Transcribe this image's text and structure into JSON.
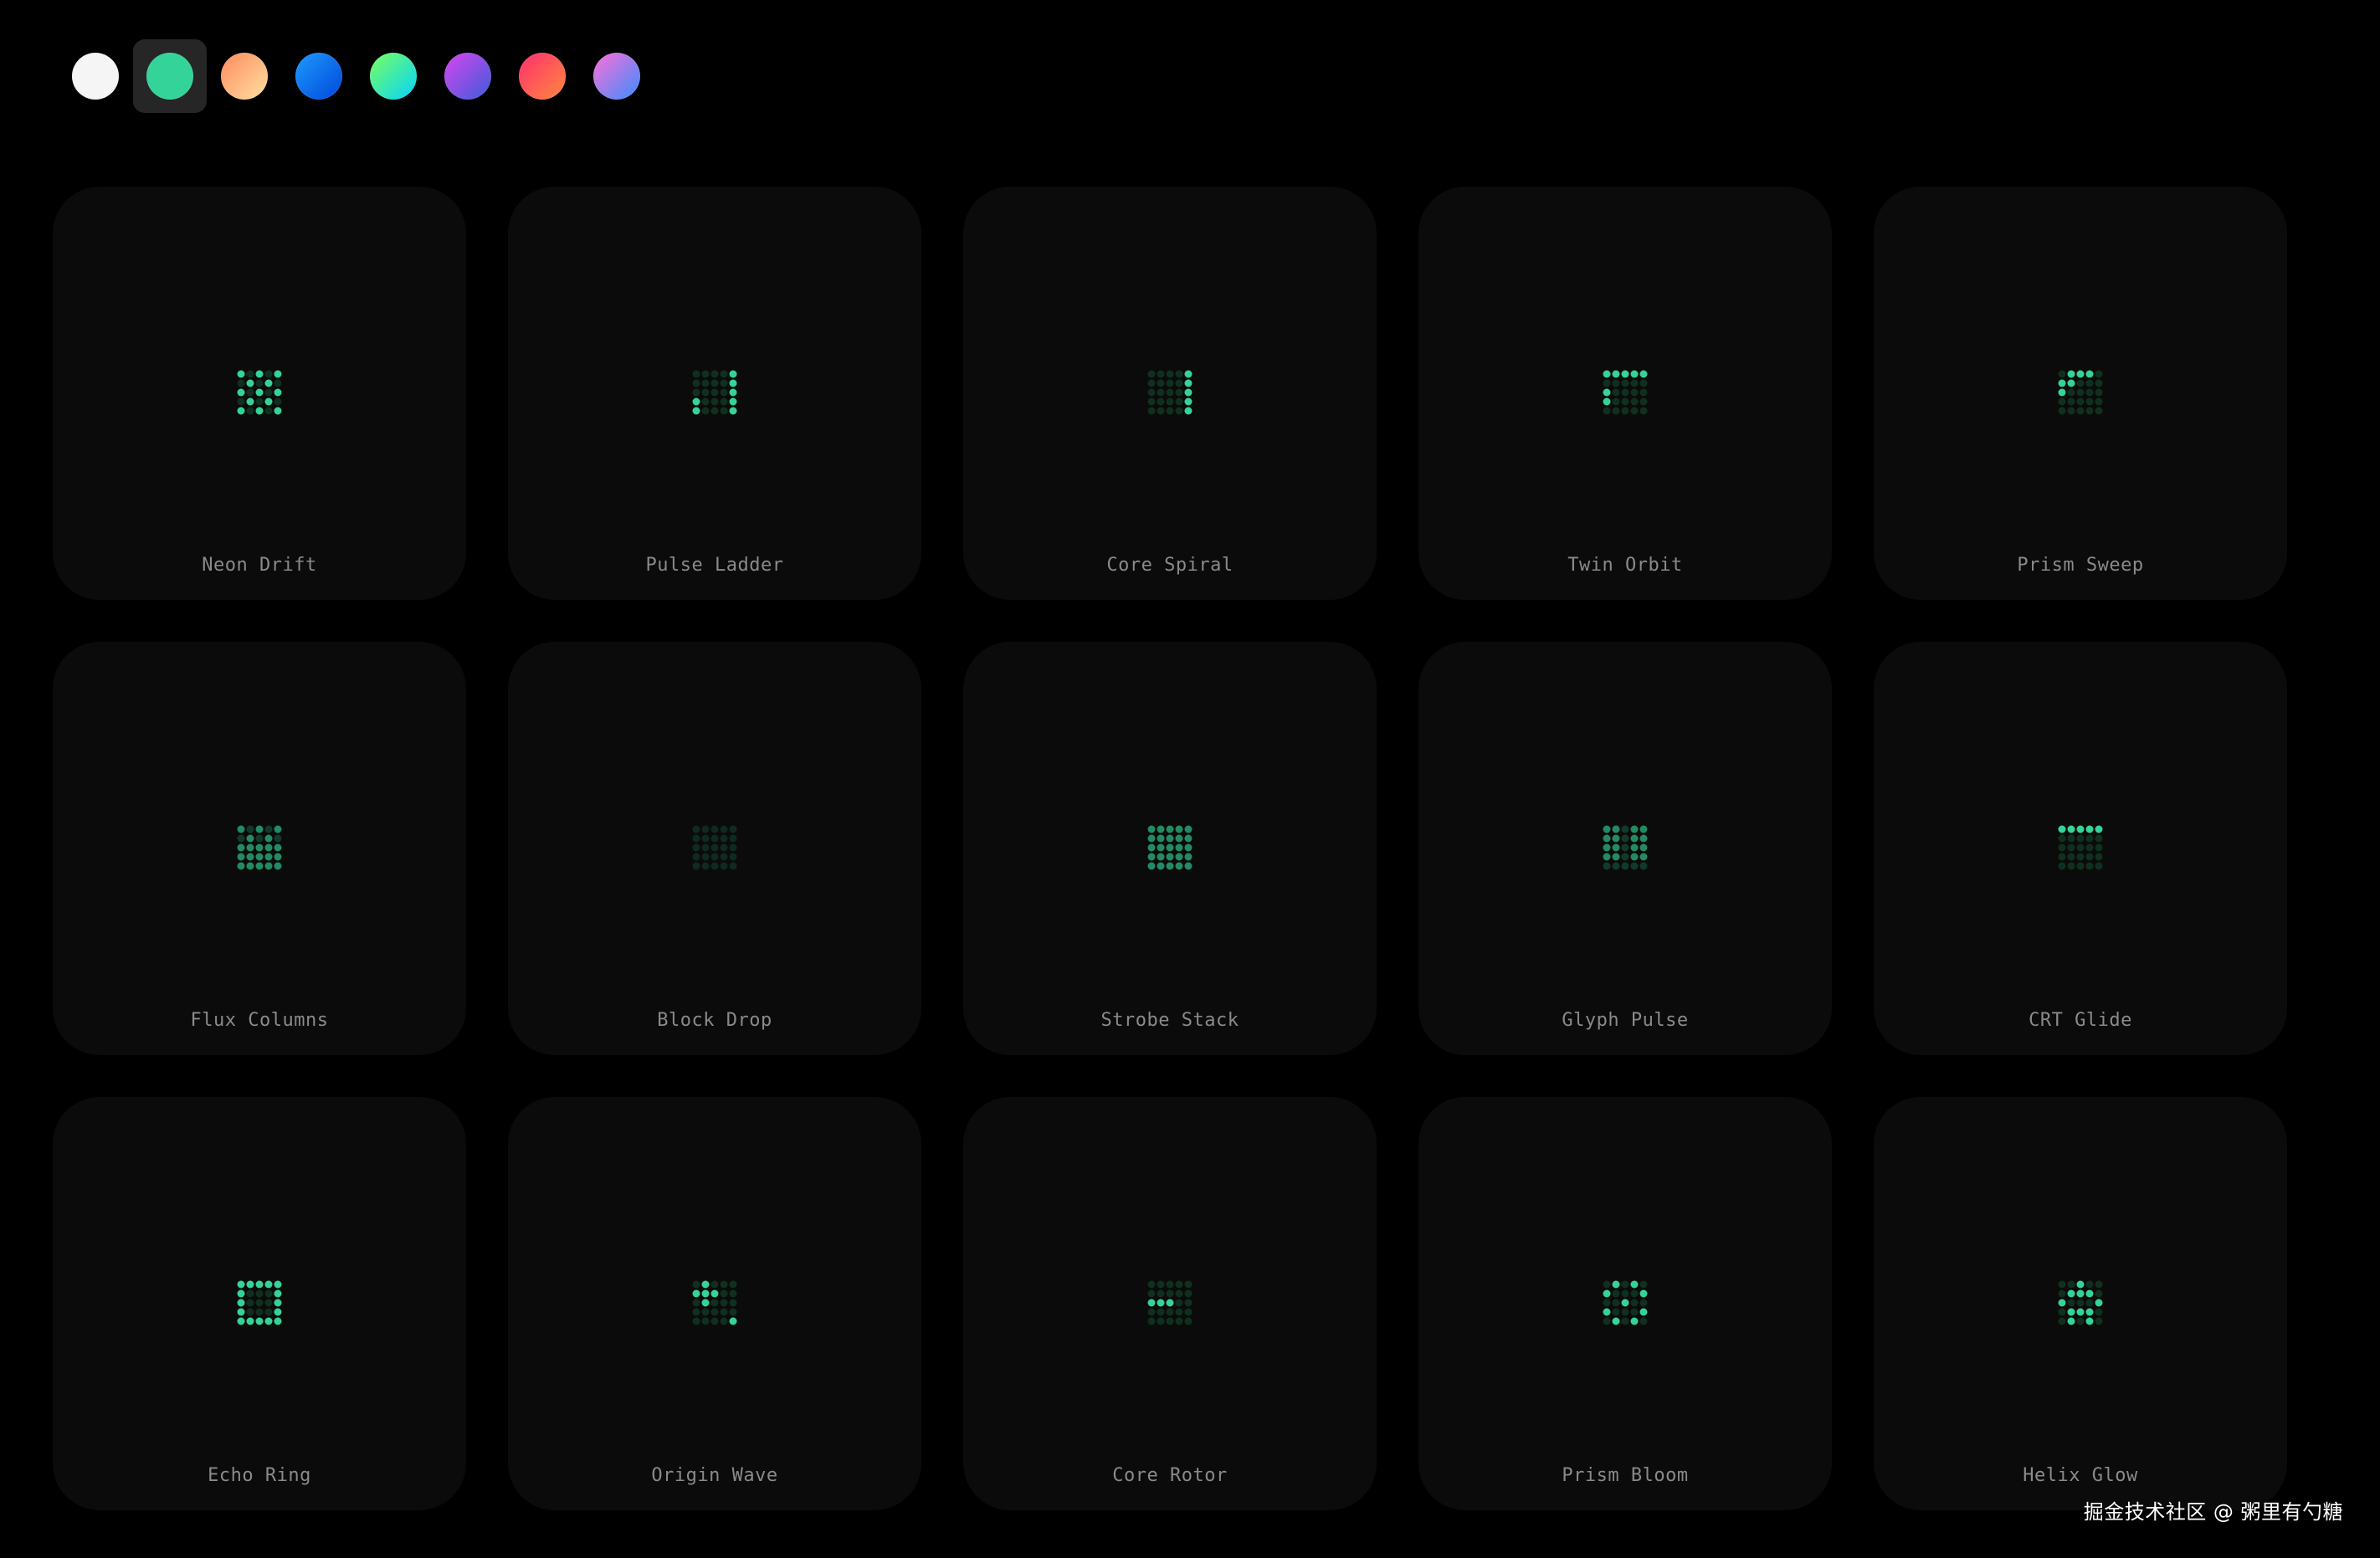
{
  "theme": {
    "accent": "#34d399",
    "card_bg": "#0b0b0b",
    "label_color": "#8a8a8a"
  },
  "swatches": [
    {
      "name": "white",
      "color": "#f5f5f5",
      "selected": false
    },
    {
      "name": "emerald",
      "color": "#34d399",
      "selected": true
    },
    {
      "name": "peach",
      "color": "linear-gradient(135deg,#ff8a5c,#ffe0a3)",
      "selected": false
    },
    {
      "name": "blue",
      "color": "linear-gradient(135deg,#1e9bff,#0047d9)",
      "selected": false
    },
    {
      "name": "mint",
      "color": "linear-gradient(135deg,#7cff5c,#00d4ff)",
      "selected": false
    },
    {
      "name": "violet",
      "color": "linear-gradient(135deg,#d946ef,#3b5bdb)",
      "selected": false
    },
    {
      "name": "rose",
      "color": "linear-gradient(135deg,#ff2d6f,#ff8a3d)",
      "selected": false
    },
    {
      "name": "aurora",
      "color": "linear-gradient(135deg,#ff6fd8,#3a8dff)",
      "selected": false
    }
  ],
  "cards": [
    {
      "label": "Neon Drift",
      "dots": [
        "1010101010101010101010101",
        "mix1"
      ]
    },
    {
      "label": "Pulse Ladder",
      "dots": [
        "0000100001000011000110001",
        "a"
      ]
    },
    {
      "label": "Core Spiral",
      "dots": [
        "0000100001000010000100001",
        "a"
      ]
    },
    {
      "label": "Twin Orbit",
      "dots": [
        "1111100000100001000000000",
        "a"
      ]
    },
    {
      "label": "Prism Sweep",
      "dots": [
        "0111011000100000000000000",
        "a"
      ]
    },
    {
      "label": "Flux Columns",
      "dots": [
        "1010101010111111111111111",
        "m"
      ]
    },
    {
      "label": "Block Drop",
      "dots": [
        "0000000000000000000000000",
        "d"
      ]
    },
    {
      "label": "Strobe Stack",
      "dots": [
        "1111111111111111111111111",
        "m"
      ]
    },
    {
      "label": "Glyph Pulse",
      "dots": [
        "1101111011110111101100000",
        "m"
      ]
    },
    {
      "label": "CRT Glide",
      "dots": [
        "1111100000000000000000000",
        "a"
      ]
    },
    {
      "label": "Echo Ring",
      "dots": [
        "1111110001100011000111111",
        "a"
      ]
    },
    {
      "label": "Origin Wave",
      "dots": [
        "0100011100010000000000001",
        "a"
      ]
    },
    {
      "label": "Core Rotor",
      "dots": [
        "0000000000111000000000000",
        "a"
      ]
    },
    {
      "label": "Prism Bloom",
      "dots": [
        "0101010001001001000101010",
        "a"
      ]
    },
    {
      "label": "Helix Glow",
      "dots": [
        "0010001110100010111001010",
        "a"
      ]
    }
  ],
  "watermark": "掘金技术社区 @ 粥里有勺糖"
}
